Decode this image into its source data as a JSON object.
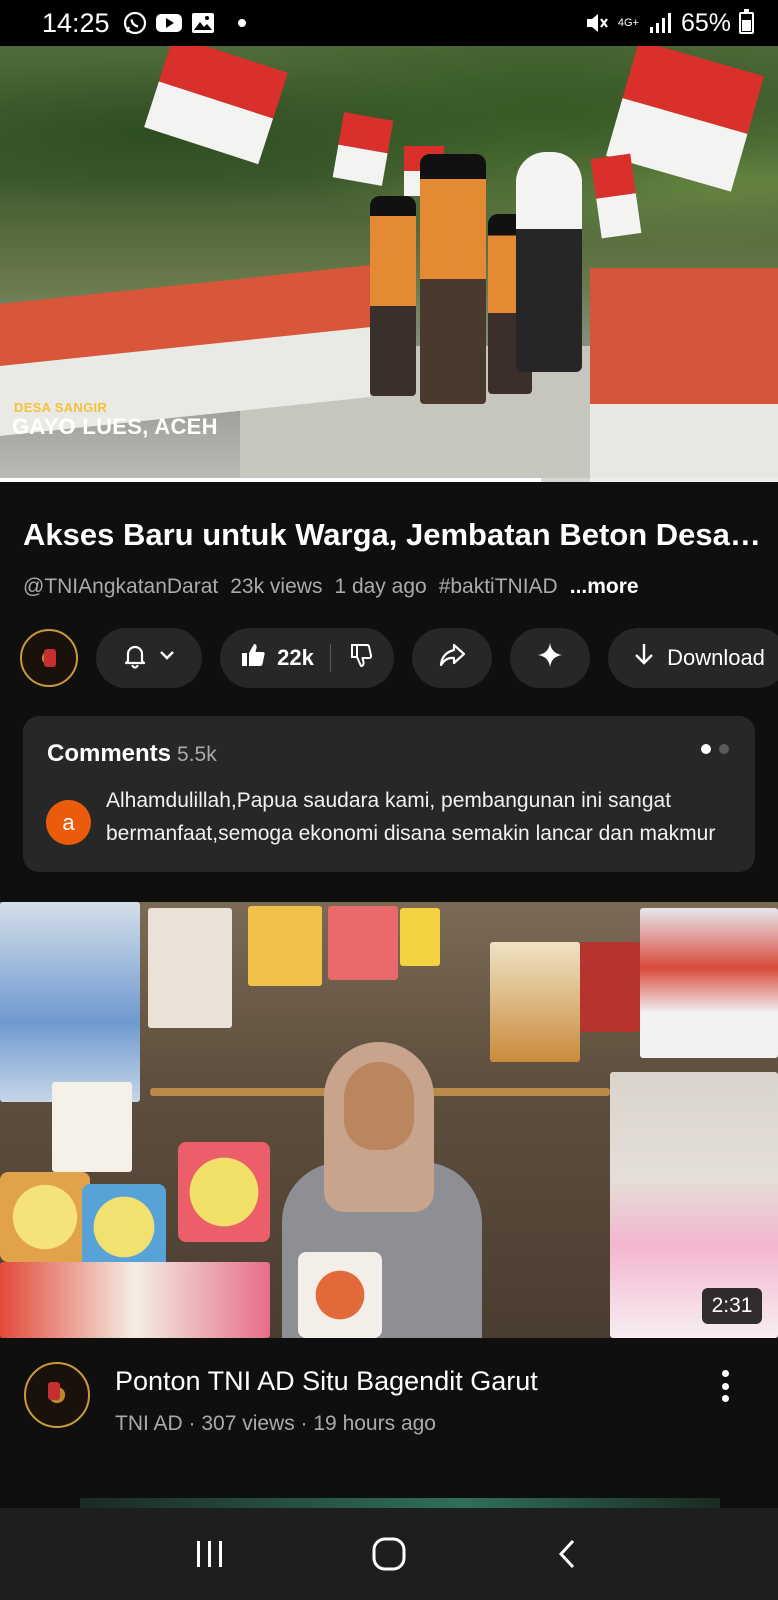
{
  "status_bar": {
    "time": "14:25",
    "network": "4G+",
    "battery": "65%",
    "icons": [
      "whatsapp-icon",
      "youtube-icon",
      "gallery-icon",
      "dot-icon",
      "mute-icon",
      "signal-icon",
      "battery-icon"
    ]
  },
  "player": {
    "overlay_small": "DESA SANGIR",
    "overlay_big": "GAYO LUES, ACEH",
    "progress": 0.695
  },
  "video": {
    "title": "Akses Baru untuk Warga, Jembatan Beton Desa Sangir Gayo Lues",
    "channel_handle": "@TNIAngkatanDarat",
    "views": "23k views",
    "age": "1 day ago",
    "hashtag": "#baktiTNIAD",
    "more": "...more"
  },
  "actions": {
    "likes": "22k",
    "download": "Download",
    "icons": [
      "bell-icon",
      "chevron-down-icon",
      "like-icon",
      "dislike-icon",
      "share-icon",
      "sparkle-icon",
      "download-icon"
    ]
  },
  "comments": {
    "label": "Comments",
    "count": "5.5k",
    "avatar_letter": "a",
    "text_line1": "Alhamdulillah,Papua saudara kami, pembangunan ini sangat",
    "text_line2": "bermanfaat,semoga ekonomi disana semakin lancar dan makmur"
  },
  "next_video": {
    "duration": "2:31",
    "title": "Ponton TNI AD Situ Bagendit Garut",
    "meta": "TNI AD · 307 views · 19 hours ago"
  },
  "colors": {
    "background": "#0f0f0f",
    "pill": "#272727",
    "comment_avatar": "#ea5c0b",
    "secondary_text": "#aaaaaa"
  }
}
